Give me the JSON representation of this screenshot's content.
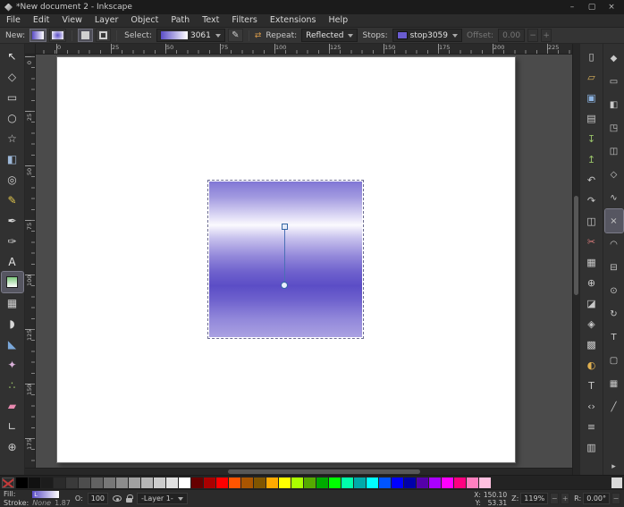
{
  "window": {
    "title": "*New document 2 - Inkscape",
    "minimize": "–",
    "maximize": "▢",
    "close": "×"
  },
  "menubar": {
    "items": [
      "File",
      "Edit",
      "View",
      "Layer",
      "Object",
      "Path",
      "Text",
      "Filters",
      "Extensions",
      "Help"
    ]
  },
  "gradient_toolbar": {
    "new_label": "New:",
    "select_label": "Select:",
    "gradient_name": "3061",
    "repeat_label": "Repeat:",
    "repeat_value": "Reflected",
    "stops_label": "Stops:",
    "stop_name": "stop3059",
    "offset_label": "Offset:",
    "offset_value": "0.00"
  },
  "icons": {
    "edit_gradient": "✎",
    "repeat_arrows": "⇄",
    "minus": "−",
    "plus": "+",
    "expander": "▸"
  },
  "tools": [
    {
      "name": "selector",
      "glyph": "↖",
      "color": "#e6e6e6"
    },
    {
      "name": "node-editor",
      "glyph": "◇",
      "color": "#cfcfcf"
    },
    {
      "name": "rectangle",
      "glyph": "▭",
      "color": "#cfcfcf"
    },
    {
      "name": "ellipse",
      "glyph": "○",
      "color": "#cfcfcf"
    },
    {
      "name": "star",
      "glyph": "☆",
      "color": "#cfcfcf"
    },
    {
      "name": "box-3d",
      "glyph": "◧",
      "color": "#9db8d8"
    },
    {
      "name": "spiral",
      "glyph": "◎",
      "color": "#cfcfcf"
    },
    {
      "name": "pencil",
      "glyph": "✎",
      "color": "#e3c84d"
    },
    {
      "name": "pen",
      "glyph": "✒",
      "color": "#d8d8d8"
    },
    {
      "name": "calligraphy",
      "glyph": "✑",
      "color": "#d8d8d8"
    },
    {
      "name": "text",
      "glyph": "A",
      "color": "#e6e6e6"
    },
    {
      "name": "gradient",
      "gradient_icon": true,
      "selected": true
    },
    {
      "name": "mesh-gradient",
      "glyph": "▦",
      "color": "#cfcfcf"
    },
    {
      "name": "dropper",
      "glyph": "◗",
      "color": "#d8d8d8"
    },
    {
      "name": "paint-bucket",
      "glyph": "◣",
      "color": "#7aa7d9"
    },
    {
      "name": "tweak",
      "glyph": "✦",
      "color": "#d8b0d8"
    },
    {
      "name": "spray",
      "glyph": "∴",
      "color": "#9ac46a"
    },
    {
      "name": "eraser",
      "glyph": "▰",
      "color": "#e88ab0"
    },
    {
      "name": "connector",
      "glyph": "∟",
      "color": "#cfcfcf"
    },
    {
      "name": "zoom",
      "glyph": "⊕",
      "color": "#cfcfcf"
    }
  ],
  "commands": [
    {
      "name": "new-document",
      "glyph": "▯",
      "color": "#d8d8d8"
    },
    {
      "name": "open-document",
      "glyph": "▱",
      "color": "#d9b15c"
    },
    {
      "name": "save-document",
      "glyph": "▣",
      "color": "#8cb4e2"
    },
    {
      "name": "print-document",
      "glyph": "▤",
      "color": "#c8c8c8"
    },
    {
      "name": "import",
      "glyph": "↧",
      "color": "#9ac46a"
    },
    {
      "name": "export",
      "glyph": "↥",
      "color": "#9ac46a"
    },
    {
      "name": "undo",
      "glyph": "↶",
      "color": "#c8c8c8"
    },
    {
      "name": "redo",
      "glyph": "↷",
      "color": "#c8c8c8"
    },
    {
      "name": "copy",
      "glyph": "◫",
      "color": "#c8c8c8"
    },
    {
      "name": "cut",
      "glyph": "✂",
      "color": "#d87a7a"
    },
    {
      "name": "paste",
      "glyph": "▦",
      "color": "#c8c8c8"
    },
    {
      "name": "zoom-drawing",
      "glyph": "⊕",
      "color": "#c8c8c8"
    },
    {
      "name": "duplicate",
      "glyph": "◪",
      "color": "#c8c8c8"
    },
    {
      "name": "create-clone",
      "glyph": "◈",
      "color": "#c8c8c8"
    },
    {
      "name": "group-objects",
      "glyph": "▩",
      "color": "#c8c8c8"
    },
    {
      "name": "fill-stroke-dialog",
      "glyph": "◐",
      "color": "#e0b050"
    },
    {
      "name": "text-dialog",
      "glyph": "T",
      "color": "#c8c8c8"
    },
    {
      "name": "xml-editor",
      "glyph": "‹›",
      "color": "#c8c8c8"
    },
    {
      "name": "align-distribute",
      "glyph": "≡",
      "color": "#c8c8c8"
    },
    {
      "name": "document-properties",
      "glyph": "▥",
      "color": "#c8c8c8"
    }
  ],
  "snap_controls": [
    {
      "name": "snap-enable",
      "glyph": "◆"
    },
    {
      "name": "snap-bounding-box",
      "glyph": "▭"
    },
    {
      "name": "snap-bbox-edges",
      "glyph": "◧"
    },
    {
      "name": "snap-bbox-corners",
      "glyph": "◳"
    },
    {
      "name": "snap-bbox-edge-midpoints",
      "glyph": "◫"
    },
    {
      "name": "snap-nodes",
      "glyph": "◇"
    },
    {
      "name": "snap-paths",
      "glyph": "∿"
    },
    {
      "name": "snap-path-intersections",
      "glyph": "×",
      "active": true
    },
    {
      "name": "snap-cusp-nodes",
      "glyph": "◠"
    },
    {
      "name": "snap-midpoints",
      "glyph": "⊟"
    },
    {
      "name": "snap-object-centers",
      "glyph": "⊙"
    },
    {
      "name": "snap-rotation-centers",
      "glyph": "↻"
    },
    {
      "name": "snap-text-baselines",
      "glyph": "T"
    },
    {
      "name": "snap-page-border",
      "glyph": "▢"
    },
    {
      "name": "snap-grids",
      "glyph": "▦"
    },
    {
      "name": "snap-guides",
      "glyph": "╱"
    }
  ],
  "rulers": {
    "horizontal_labels": [
      "0",
      "25",
      "50",
      "75",
      "100",
      "125",
      "150",
      "175",
      "200",
      "225"
    ],
    "vertical_labels": [
      "0",
      "25",
      "50",
      "75",
      "100",
      "125",
      "150",
      "175"
    ]
  },
  "canvas": {
    "gradient_type": "linear-reflected",
    "gradient_stops": [
      {
        "color": "#8177d5",
        "pos": "0%"
      },
      {
        "color": "#a29ae0",
        "pos": "10%"
      },
      {
        "color": "#ddd9f5",
        "pos": "22%"
      },
      {
        "color": "#fbfafe",
        "pos": "28%"
      },
      {
        "color": "#c9c3ee",
        "pos": "36%"
      },
      {
        "color": "#9388da",
        "pos": "48%"
      },
      {
        "color": "#6f62cd",
        "pos": "58%"
      },
      {
        "color": "#5b4dc6",
        "pos": "67%"
      },
      {
        "color": "#6e61cd",
        "pos": "76%"
      },
      {
        "color": "#9187da",
        "pos": "88%"
      },
      {
        "color": "#aaa1e2",
        "pos": "100%"
      }
    ],
    "gradient_preview": {
      "from": "#5b4dc6",
      "to": "#ffffff"
    },
    "stop_swatch_color": "#6a5cd0"
  },
  "palette": {
    "colors": [
      "#000000",
      "#111111",
      "#1c1c1c",
      "#2b2b2b",
      "#3a3a3a",
      "#4d4d4d",
      "#626262",
      "#777777",
      "#8c8c8c",
      "#a1a1a1",
      "#b6b6b6",
      "#cccccc",
      "#e1e1e1",
      "#ffffff",
      "#660000",
      "#aa0000",
      "#ff0000",
      "#ff5500",
      "#aa5500",
      "#805500",
      "#ffaa00",
      "#ffff00",
      "#aaff00",
      "#55aa00",
      "#00aa00",
      "#00ff00",
      "#00ffaa",
      "#00aaaa",
      "#00ffff",
      "#0055ff",
      "#0000ff",
      "#0000aa",
      "#5500aa",
      "#aa00ff",
      "#ff00ff",
      "#ff0080",
      "#ff80c0",
      "#ffc0e0"
    ]
  },
  "statusbar": {
    "fill_label": "Fill:",
    "fill_type": "L",
    "stroke_label": "Stroke:",
    "stroke_value": "None",
    "stroke_width": "1.87",
    "opacity_label": "O:",
    "opacity_value": "100",
    "layer_value": "-Layer 1-",
    "x_label": "X:",
    "x_value": "150.10",
    "y_label": "Y:",
    "y_value": "53.31",
    "zoom_label": "Z:",
    "zoom_value": "119%",
    "rotation_label": "R:",
    "rotation_value": "0.00°"
  }
}
